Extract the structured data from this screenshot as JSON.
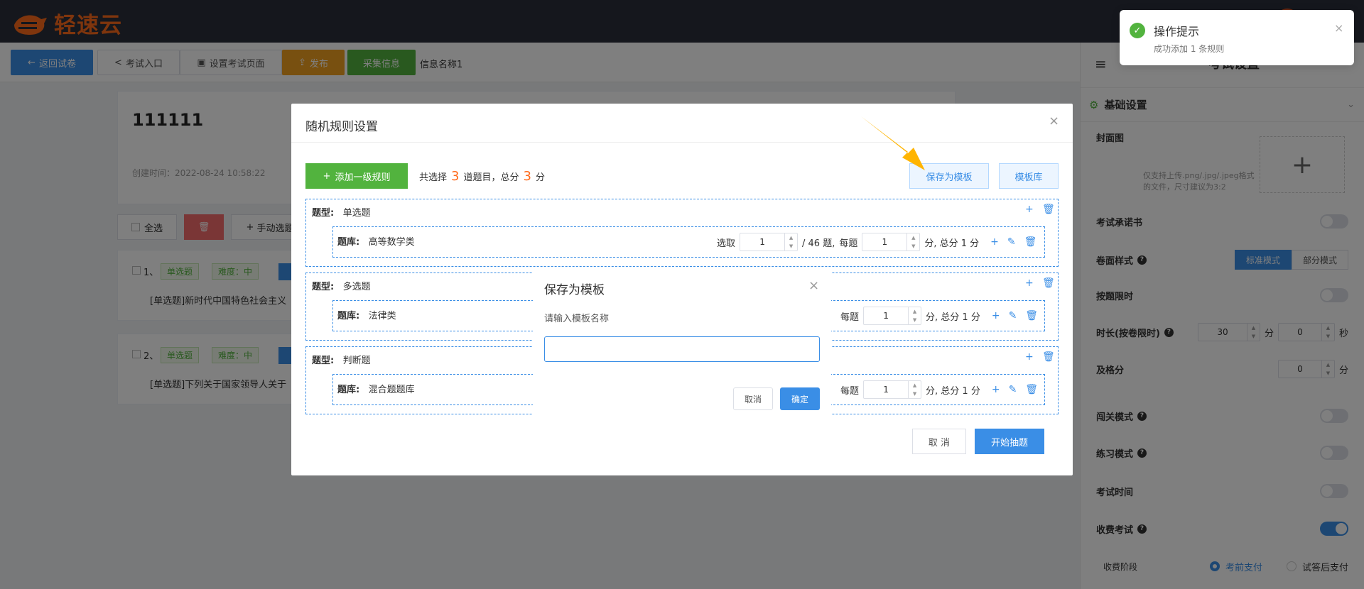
{
  "app": {
    "logo_text": "轻速云"
  },
  "toolbar": {
    "back_label": "返回试卷",
    "exam_entry_label": "考试入口",
    "set_exam_page_label": "设置考试页面",
    "publish_label": "发布",
    "collect_info_label": "采集信息",
    "info_name_label": "信息名称1"
  },
  "paper": {
    "title": "111111",
    "created_label": "创建时间：2022-08-24 10:58:22",
    "select_all_label": "全选",
    "manual_select_label": "手动选题",
    "questions": [
      {
        "num": "1、",
        "type": "单选题",
        "difficulty": "难度：中",
        "text": "[单选题]新时代中国特色社会主义"
      },
      {
        "num": "2、",
        "type": "单选题",
        "difficulty": "难度：中",
        "text": "[单选题]下列关于国家领导人关于"
      }
    ]
  },
  "rules_dialog": {
    "title": "随机规则设置",
    "add_rule_label": "添加一级规则",
    "summary_prefix": "共选择",
    "summary_count": "3",
    "summary_mid": "道题目，总分",
    "summary_score": "3",
    "summary_suffix": "分",
    "save_template_label": "保存为模板",
    "template_lib_label": "模板库",
    "type_label": "题型:",
    "bank_label": "题库:",
    "select_label": "选取",
    "per_label": "每题",
    "rules": [
      {
        "type": "单选题",
        "bank": "高等数学类",
        "select": "1",
        "total": "/ 46 题,",
        "per": "1",
        "score": "分, 总分 1 分"
      },
      {
        "type": "多选题",
        "bank": "法律类",
        "per": "1",
        "score": "分, 总分 1 分"
      },
      {
        "type": "判断题",
        "bank": "混合题题库",
        "per": "1",
        "score": "分, 总分 1 分"
      }
    ],
    "cancel_label": "取 消",
    "start_label": "开始抽题"
  },
  "save_modal": {
    "title": "保存为模板",
    "prompt": "请输入模板名称",
    "input_value": "",
    "cancel_label": "取消",
    "confirm_label": "确定"
  },
  "toast": {
    "title": "操作提示",
    "message": "成功添加 1 条规则"
  },
  "panel": {
    "header_title": "考试设置",
    "section_title": "基础设置",
    "cover_label": "封面图",
    "cover_hint": "仅支持上传.png/.jpg/.jpeg格式的文件，尺寸建议为3:2",
    "commitment_label": "考试承诺书",
    "paper_style_label": "卷面样式",
    "style_standard": "标准模式",
    "style_partial": "部分模式",
    "time_limit_label": "按题限时",
    "duration_label": "时长(按卷限时)",
    "duration_min": "30",
    "min_unit": "分",
    "duration_sec": "0",
    "sec_unit": "秒",
    "pass_label": "及格分",
    "pass_value": "0",
    "pass_unit": "分",
    "level_mode_label": "闯关模式",
    "practice_mode_label": "练习模式",
    "exam_time_label": "考试时间",
    "paid_exam_label": "收费考试",
    "pay_stage_label": "收费阶段",
    "pay_before": "考前支付",
    "pay_after": "试答后支付",
    "toggles": {
      "commitment": false,
      "time_limit": false,
      "level_mode": false,
      "practice_mode": false,
      "exam_time": false,
      "paid_exam": true
    }
  },
  "colors": {
    "primary": "#3a8ee6",
    "success": "#52b33e",
    "warning": "#f0a020",
    "danger": "#f56c6c",
    "accent_orange": "#ff6a1a",
    "arrow": "#ffb400"
  }
}
